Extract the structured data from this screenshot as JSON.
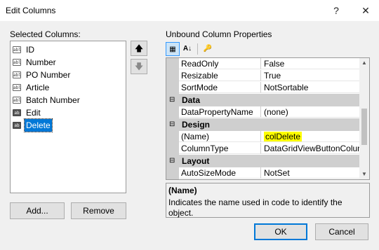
{
  "window": {
    "title": "Edit Columns",
    "help_glyph": "?",
    "close_glyph": "✕"
  },
  "selected_columns": {
    "label": "Selected Columns:",
    "items": [
      {
        "label": "ID",
        "icon": "text-column-icon"
      },
      {
        "label": "Number",
        "icon": "text-column-icon"
      },
      {
        "label": "PO Number",
        "icon": "text-column-icon"
      },
      {
        "label": "Article",
        "icon": "text-column-icon"
      },
      {
        "label": "Batch Number",
        "icon": "text-column-icon"
      },
      {
        "label": "Edit",
        "icon": "button-column-icon"
      },
      {
        "label": "Delete",
        "icon": "button-column-icon",
        "selected": true
      }
    ],
    "icon_text": "abl",
    "icon_button_text": "ab",
    "move_up_glyph": "🡅",
    "move_down_glyph": "🡇",
    "add_label": "Add...",
    "remove_label": "Remove"
  },
  "properties": {
    "label": "Unbound Column Properties",
    "toolbar": {
      "categorized_glyph": "▦",
      "alphabetical_glyph": "A↓",
      "property_pages_glyph": "🔑"
    },
    "rows": [
      {
        "name": "ReadOnly",
        "value": "False"
      },
      {
        "name": "Resizable",
        "value": "True"
      },
      {
        "name": "SortMode",
        "value": "NotSortable"
      }
    ],
    "categories": [
      {
        "name": "Data",
        "toggle": "⊟",
        "rows": [
          {
            "name": "DataPropertyName",
            "value": "(none)"
          }
        ]
      },
      {
        "name": "Design",
        "toggle": "⊟",
        "rows": [
          {
            "name": "(Name)",
            "value": "colDelete",
            "highlighted": true
          },
          {
            "name": "ColumnType",
            "value": "DataGridViewButtonColumn"
          }
        ]
      },
      {
        "name": "Layout",
        "toggle": "⊟",
        "rows": [
          {
            "name": "AutoSizeMode",
            "value": "NotSet"
          }
        ]
      }
    ],
    "scroll_up_glyph": "▲",
    "scroll_down_glyph": "▼",
    "description": {
      "title": "(Name)",
      "text": "Indicates the name used in code to identify the object."
    }
  },
  "footer": {
    "ok_label": "OK",
    "cancel_label": "Cancel"
  },
  "colors": {
    "selection": "#0078d7",
    "highlight": "#ffff00",
    "category_bg": "#cfcfcf",
    "dialog_bg": "#f0f0f0"
  }
}
